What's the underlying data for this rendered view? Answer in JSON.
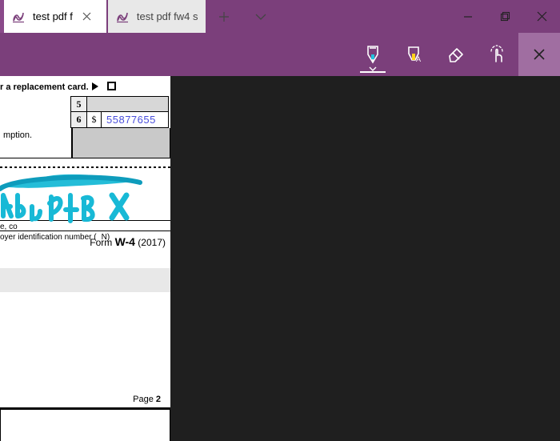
{
  "tabs": [
    {
      "title": "test pdf f"
    },
    {
      "title": "test pdf fw4 s"
    }
  ],
  "toolbar": {
    "pen": "pen-icon",
    "highlighter": "highlighter-icon",
    "eraser": "eraser-icon",
    "touch": "touch-write-icon",
    "close": "close-icon"
  },
  "form": {
    "replace_text": "r a replacement card.",
    "row5_num": "5",
    "row6_num": "6",
    "row6_dollar": "$",
    "row6_value": "55877655",
    "mption_text": "mption.",
    "sig_small_text_1": "e, co",
    "sig_small_text_2": "oyer identification number (",
    "sig_small_text_3": "N)",
    "form_foot_prefix": "Form ",
    "form_foot_name": "W-4",
    "form_foot_year": " (2017)",
    "page2_label": "Page ",
    "page2_num": "2"
  }
}
